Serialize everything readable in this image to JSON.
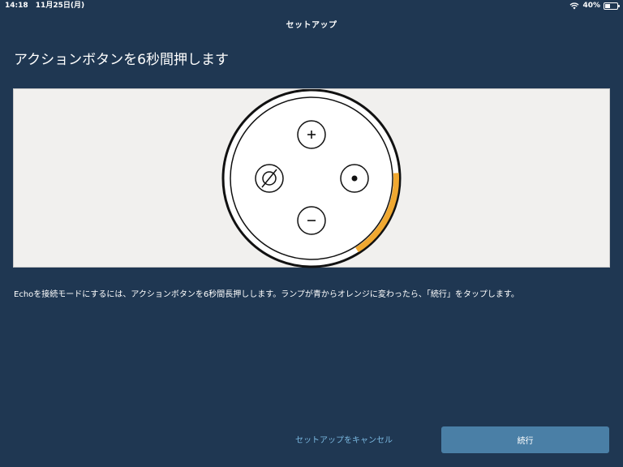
{
  "status_bar": {
    "time": "14:18",
    "date": "11月25日(月)",
    "battery": "40%",
    "battery_level": 0.4
  },
  "nav": {
    "title": "セットアップ"
  },
  "page": {
    "heading": "アクションボタンを6秒間押します",
    "instruction": "Echoを接続モードにするには、アクションボタンを6秒間長押しします。ランプが青からオレンジに変わったら、「続行」をタップします。"
  },
  "device": {
    "buttons": [
      {
        "name": "volume-up-button",
        "icon": "plus-icon"
      },
      {
        "name": "mic-off-button",
        "icon": "mic-off-icon"
      },
      {
        "name": "action-button",
        "icon": "dot-icon"
      },
      {
        "name": "volume-down-button",
        "icon": "minus-icon"
      }
    ],
    "ring_color": "#f0a830",
    "ring_progress": 0.17
  },
  "actions": {
    "cancel_label": "セットアップをキャンセル",
    "continue_label": "続行"
  },
  "colors": {
    "background": "#1f3752",
    "link": "#7ab8e0",
    "button": "#4a7fa6",
    "accent_orange": "#f0a830"
  }
}
